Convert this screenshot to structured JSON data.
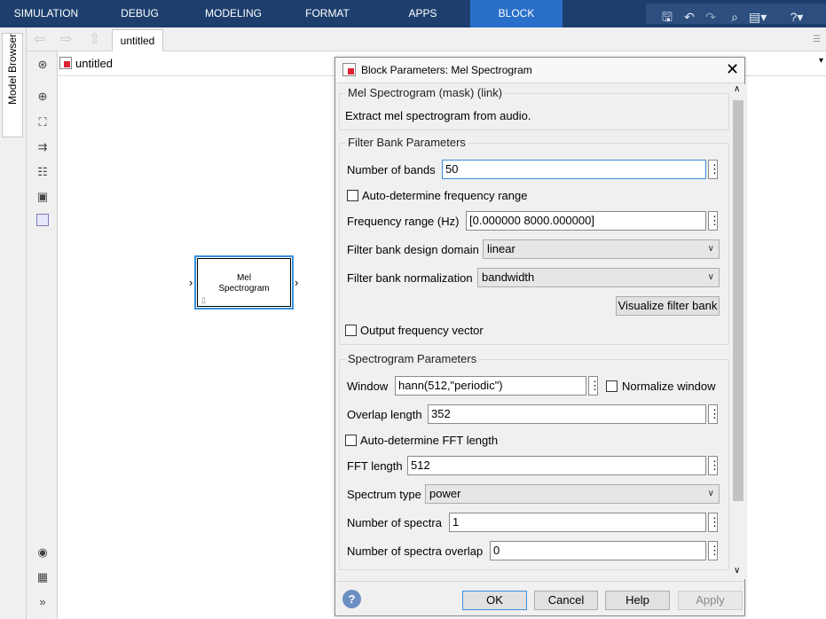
{
  "ribbon": {
    "tabs": [
      "SIMULATION",
      "DEBUG",
      "MODELING",
      "FORMAT",
      "APPS",
      "BLOCK"
    ],
    "active_tab": "BLOCK",
    "quick_access_icons": [
      "save-icon",
      "undo-icon",
      "redo-icon",
      "search-icon",
      "breakpoint-icon",
      "help-icon"
    ]
  },
  "toolbar": {
    "tab_label": "untitled"
  },
  "sidebar": {
    "model_browser_label": "Model Browser"
  },
  "canvas": {
    "address": "untitled",
    "block": {
      "line1": "Mel",
      "line2": "Spectrogram"
    }
  },
  "dialog": {
    "title": "Block Parameters: Mel Spectrogram",
    "mask_group_title": "Mel Spectrogram (mask) (link)",
    "description": "Extract mel spectrogram from audio.",
    "filter_bank": {
      "title": "Filter Bank Parameters",
      "num_bands_label": "Number of bands",
      "num_bands_value": "50",
      "auto_freq_label": "Auto-determine frequency range",
      "freq_range_label": "Frequency range (Hz)",
      "freq_range_value": "[0.000000 8000.000000]",
      "design_domain_label": "Filter bank design domain",
      "design_domain_value": "linear",
      "normalization_label": "Filter bank normalization",
      "normalization_value": "bandwidth",
      "visualize_button": "Visualize filter bank",
      "output_freq_label": "Output frequency vector"
    },
    "spectrogram": {
      "title": "Spectrogram Parameters",
      "window_label": "Window",
      "window_value": "hann(512,\"periodic\")",
      "normalize_window_label": "Normalize window",
      "overlap_label": "Overlap length",
      "overlap_value": "352",
      "auto_fft_label": "Auto-determine FFT length",
      "fft_label": "FFT length",
      "fft_value": "512",
      "spectrum_type_label": "Spectrum type",
      "spectrum_type_value": "power",
      "num_spectra_label": "Number of spectra",
      "num_spectra_value": "1",
      "num_spectra_overlap_label": "Number of spectra overlap",
      "num_spectra_overlap_value": "0"
    },
    "buttons": {
      "ok": "OK",
      "cancel": "Cancel",
      "help": "Help",
      "apply": "Apply"
    }
  }
}
